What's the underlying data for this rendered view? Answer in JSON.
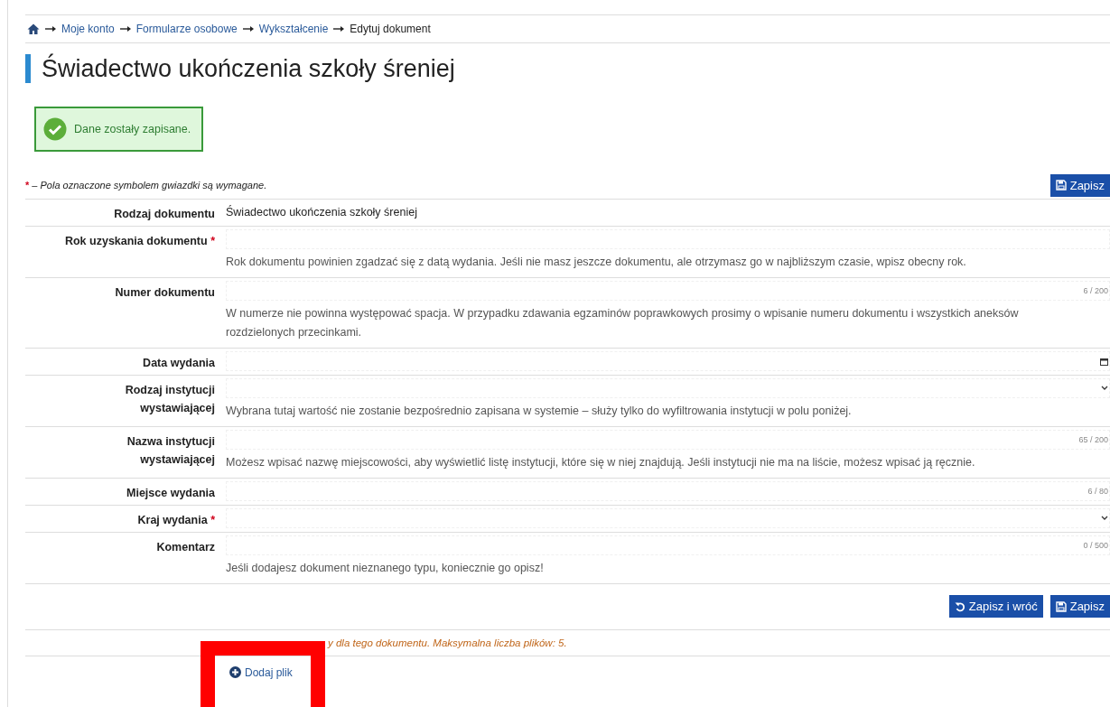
{
  "breadcrumb": {
    "links": [
      "Moje konto",
      "Formularze osobowe",
      "Wykształcenie"
    ],
    "current": "Edytuj dokument"
  },
  "title": "Świadectwo ukończenia szkoły śreniej",
  "notice": {
    "text": "Dane zostały zapisane."
  },
  "required_note": {
    "mark": "*",
    "text": "– Pola oznaczone symbolem gwiazdki są wymagane."
  },
  "top_buttons": [
    {
      "label": "Zapisz",
      "kind": "save"
    }
  ],
  "fields": [
    {
      "label": "Rodzaj dokumentu",
      "required": false,
      "kind": "static",
      "value": "Świadectwo ukończenia szkoły śreniej"
    },
    {
      "label": "Rok uzyskania dokumentu",
      "required": true,
      "kind": "text",
      "hint": "Rok dokumentu powinien zgadzać się z datą wydania. Jeśli nie masz jeszcze dokumentu, ale otrzymasz go w najbliższym czasie, wpisz obecny rok."
    },
    {
      "label": "Numer dokumentu",
      "required": false,
      "kind": "text",
      "counter": "6 / 200",
      "hint": "W numerze nie powinna występować spacja. W przypadku zdawania egzaminów poprawkowych prosimy o wpisanie numeru dokumentu i wszystkich aneksów rozdzielonych przecinkami."
    },
    {
      "label": "Data wydania",
      "required": false,
      "kind": "date"
    },
    {
      "label": "Rodzaj instytucji\nwystawiającej",
      "required": false,
      "kind": "select",
      "hint": "Wybrana tutaj wartość nie zostanie bezpośrednio zapisana w systemie – służy tylko do wyfiltrowania instytucji w polu poniżej."
    },
    {
      "label": "Nazwa instytucji\nwystawiającej",
      "required": false,
      "kind": "text",
      "counter": "65 / 200",
      "hint": "Możesz wpisać nazwę miejscowości, aby wyświetlić listę instytucji, które się w niej znajdują. Jeśli instytucji nie ma na liście, możesz wpisać ją ręcznie."
    },
    {
      "label": "Miejsce wydania",
      "required": false,
      "kind": "text",
      "counter": "6 / 80"
    },
    {
      "label": "Kraj wydania",
      "required": true,
      "kind": "select"
    },
    {
      "label": "Komentarz",
      "required": false,
      "kind": "text",
      "counter": "0 / 500",
      "hint": "Jeśli dodajesz dokument nieznanego typu, koniecznie go opisz!"
    }
  ],
  "bottom_buttons": [
    {
      "label": "Zapisz i wróć",
      "kind": "back"
    },
    {
      "label": "Zapisz",
      "kind": "save"
    }
  ],
  "files_note": "y dla tego dokumentu. Maksymalna liczba plików: 5.",
  "add_file": "Dodaj plik"
}
